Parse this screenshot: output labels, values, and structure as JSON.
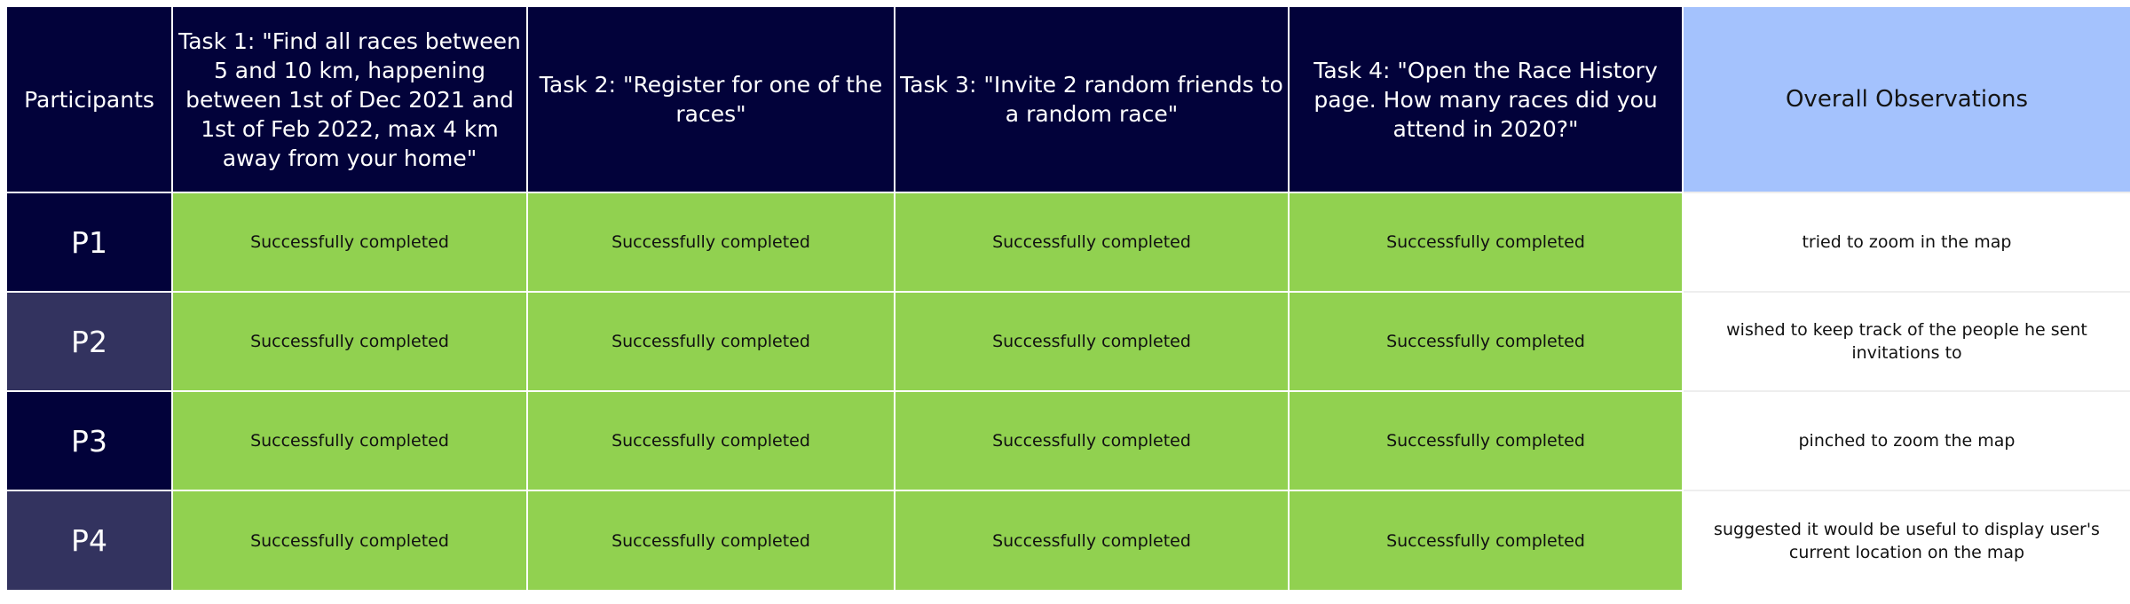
{
  "header": {
    "participants": "Participants",
    "task1": "Task 1: \"Find all races between 5 and 10 km, happening between 1st of Dec 2021 and 1st of Feb 2022, max 4 km away from your home\"",
    "task2": "Task 2: \"Register for one of the races\"",
    "task3": "Task 3: \"Invite 2 random friends to a random race\"",
    "task4": "Task 4: \"Open the Race History page. How many races did you attend in 2020?\"",
    "observations": "Overall Observations"
  },
  "rows": [
    {
      "participant": "P1",
      "task1": "Successfully completed",
      "task2": "Successfully completed",
      "task3": "Successfully completed",
      "task4": "Successfully completed",
      "observation": "tried to zoom in the map"
    },
    {
      "participant": "P2",
      "task1": "Successfully completed",
      "task2": "Successfully completed",
      "task3": "Successfully completed",
      "task4": "Successfully completed",
      "observation": "wished to keep track of the people he sent invitations to"
    },
    {
      "participant": "P3",
      "task1": "Successfully completed",
      "task2": "Successfully completed",
      "task3": "Successfully completed",
      "task4": "Successfully completed",
      "observation": "pinched to zoom the map"
    },
    {
      "participant": "P4",
      "task1": "Successfully completed",
      "task2": "Successfully completed",
      "task3": "Successfully completed",
      "task4": "Successfully completed",
      "observation": "suggested it would be useful to display user's current location on the map"
    }
  ],
  "colors": {
    "header_dark": "#02023a",
    "participant_alt": "#33335f",
    "success_green": "#91d150",
    "observations_header": "#a4c2fd"
  }
}
